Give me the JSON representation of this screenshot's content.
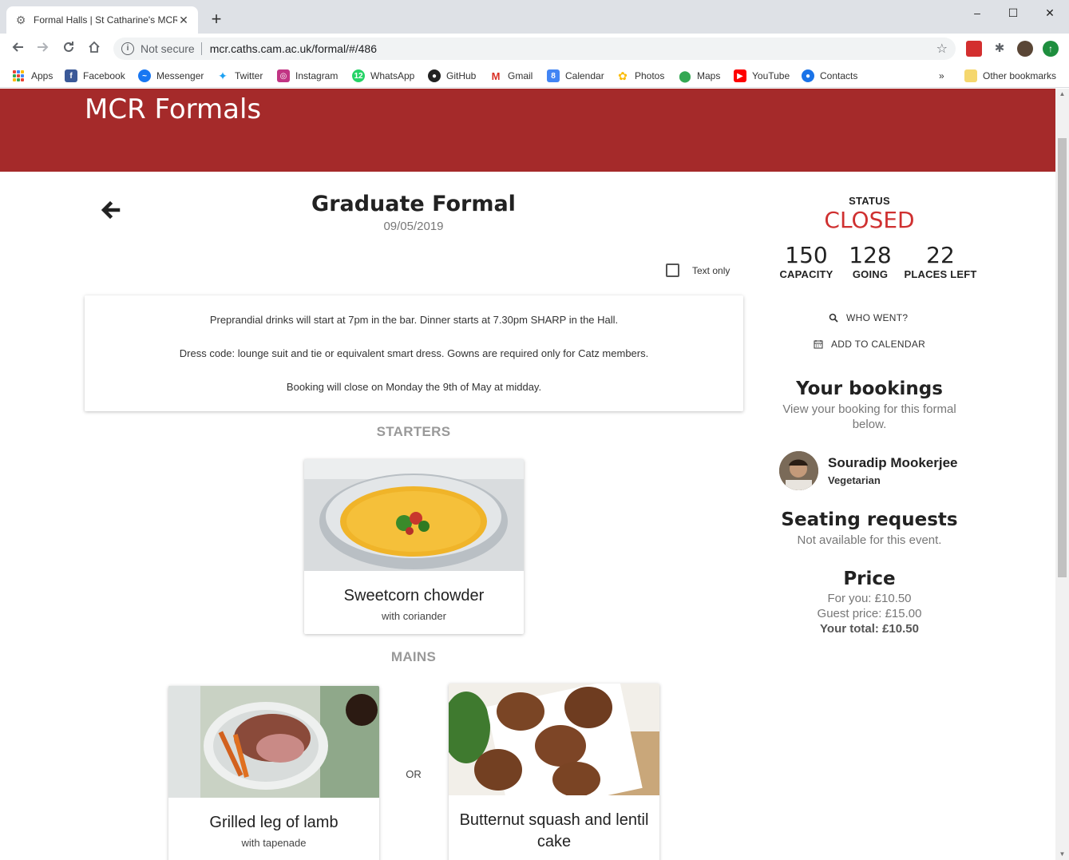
{
  "browser": {
    "tab_title": "Formal Halls | St Catharine's MCR",
    "not_secure": "Not secure",
    "url": "mcr.caths.cam.ac.uk/formal/#/486",
    "bookmarks": [
      {
        "label": "Apps",
        "icon": "apps-grid-icon"
      },
      {
        "label": "Facebook",
        "icon": "facebook-icon",
        "color": "#3b5998"
      },
      {
        "label": "Messenger",
        "icon": "messenger-icon",
        "color": "#1877f2"
      },
      {
        "label": "Twitter",
        "icon": "twitter-icon",
        "color": "#1da1f2"
      },
      {
        "label": "Instagram",
        "icon": "instagram-icon",
        "color": "#c13584"
      },
      {
        "label": "WhatsApp",
        "icon": "whatsapp-icon",
        "color": "#25d366"
      },
      {
        "label": "GitHub",
        "icon": "github-icon",
        "color": "#222222"
      },
      {
        "label": "Gmail",
        "icon": "gmail-icon",
        "color": "#d93025"
      },
      {
        "label": "Calendar",
        "icon": "calendar-icon",
        "color": "#4285f4"
      },
      {
        "label": "Photos",
        "icon": "photos-icon",
        "color": "#fbbc04"
      },
      {
        "label": "Maps",
        "icon": "maps-icon",
        "color": "#34a853"
      },
      {
        "label": "YouTube",
        "icon": "youtube-icon",
        "color": "#ff0000"
      },
      {
        "label": "Contacts",
        "icon": "contacts-icon",
        "color": "#1a73e8"
      }
    ],
    "more_bookmarks": "»",
    "other_bookmarks": "Other bookmarks"
  },
  "site": {
    "title": "MCR Formals",
    "brand_color": "#a52a2a"
  },
  "event": {
    "title": "Graduate Formal",
    "date": "09/05/2019",
    "text_only_label": "Text only",
    "text_only_checked": false,
    "description": [
      "Preprandial drinks will start at 7pm in the bar. Dinner starts at 7.30pm SHARP in the Hall.",
      "Dress code: lounge suit and tie or equivalent smart dress. Gowns are required only for Catz members.",
      "Booking will close on Monday the 9th of May at midday."
    ]
  },
  "menu": {
    "starters_heading": "STARTERS",
    "starters": [
      {
        "name": "Sweetcorn chowder",
        "sub": "with coriander"
      }
    ],
    "mains_heading": "MAINS",
    "or_label": "OR",
    "mains": [
      {
        "name": "Grilled leg of lamb",
        "sub": "with tapenade"
      },
      {
        "name": "Butternut squash and lentil cake",
        "sub": ""
      }
    ]
  },
  "sidebar": {
    "status_label": "STATUS",
    "status_value": "CLOSED",
    "status_color": "#cf3030",
    "stats": [
      {
        "value": "150",
        "label": "CAPACITY"
      },
      {
        "value": "128",
        "label": "GOING"
      },
      {
        "value": "22",
        "label": "PLACES LEFT"
      }
    ],
    "who_went": "WHO WENT?",
    "add_to_calendar": "ADD TO CALENDAR",
    "bookings_heading": "Your bookings",
    "bookings_text": "View your booking for this formal below.",
    "booker_name": "Souradip Mookerjee",
    "booker_diet": "Vegetarian",
    "seating_heading": "Seating requests",
    "seating_text": "Not available for this event.",
    "price_heading": "Price",
    "price_you": "For you: £10.50",
    "price_guest": "Guest price: £15.00",
    "price_total": "Your total: £10.50"
  }
}
